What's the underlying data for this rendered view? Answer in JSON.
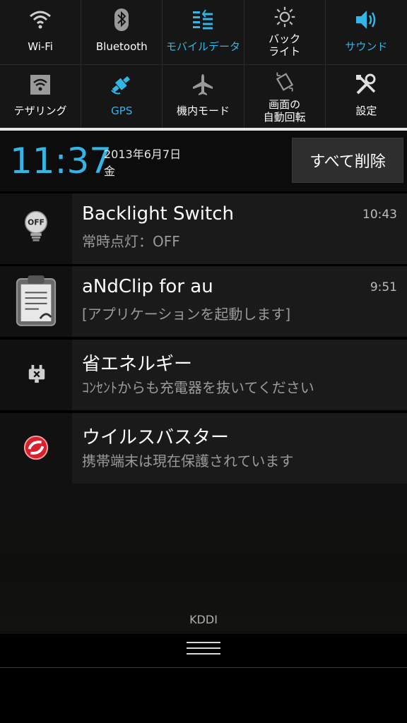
{
  "quick_settings": {
    "row1": [
      {
        "label": "Wi-Fi",
        "icon": "wifi-icon",
        "active": false
      },
      {
        "label": "Bluetooth",
        "icon": "bluetooth-icon",
        "active": false
      },
      {
        "label": "モバイルデータ",
        "icon": "mobile-data-icon",
        "active": true
      },
      {
        "label_line1": "バック",
        "label_line2": "ライト",
        "icon": "brightness-icon",
        "active": false
      },
      {
        "label": "サウンド",
        "icon": "sound-icon",
        "active": true
      }
    ],
    "row2": [
      {
        "label": "テザリング",
        "icon": "tethering-icon",
        "active": false
      },
      {
        "label": "GPS",
        "icon": "gps-icon",
        "active": true
      },
      {
        "label": "機内モード",
        "icon": "airplane-icon",
        "active": false
      },
      {
        "label_line1": "画面の",
        "label_line2": "自動回転",
        "icon": "auto-rotate-icon",
        "active": false
      },
      {
        "label": "設定",
        "icon": "settings-icon",
        "active": false
      }
    ]
  },
  "header": {
    "time": "11:37",
    "date": "2013年6月7日",
    "weekday": "金",
    "clear_all_label": "すべて削除"
  },
  "notifications": [
    {
      "title": "Backlight Switch",
      "text": "常時点灯：OFF",
      "time": "10:43",
      "icon": "backlight-off-icon"
    },
    {
      "title": "aNdClip for au",
      "text": "[アプリケーションを起動します]",
      "time": "9:51",
      "icon": "clipboard-icon"
    },
    {
      "title": "省エネルギー",
      "text": "ｺﾝｾﾝﾄからも充電器を抜いてください",
      "time": "",
      "icon": "plug-icon"
    },
    {
      "title": "ウイルスバスター",
      "text": "携帯端末は現在保護されています",
      "time": "",
      "icon": "virusbuster-icon"
    }
  ],
  "carrier": "KDDI",
  "colors": {
    "accent": "#33b5e5",
    "background": "#000000",
    "notification_bg": "#1a1a1a"
  }
}
